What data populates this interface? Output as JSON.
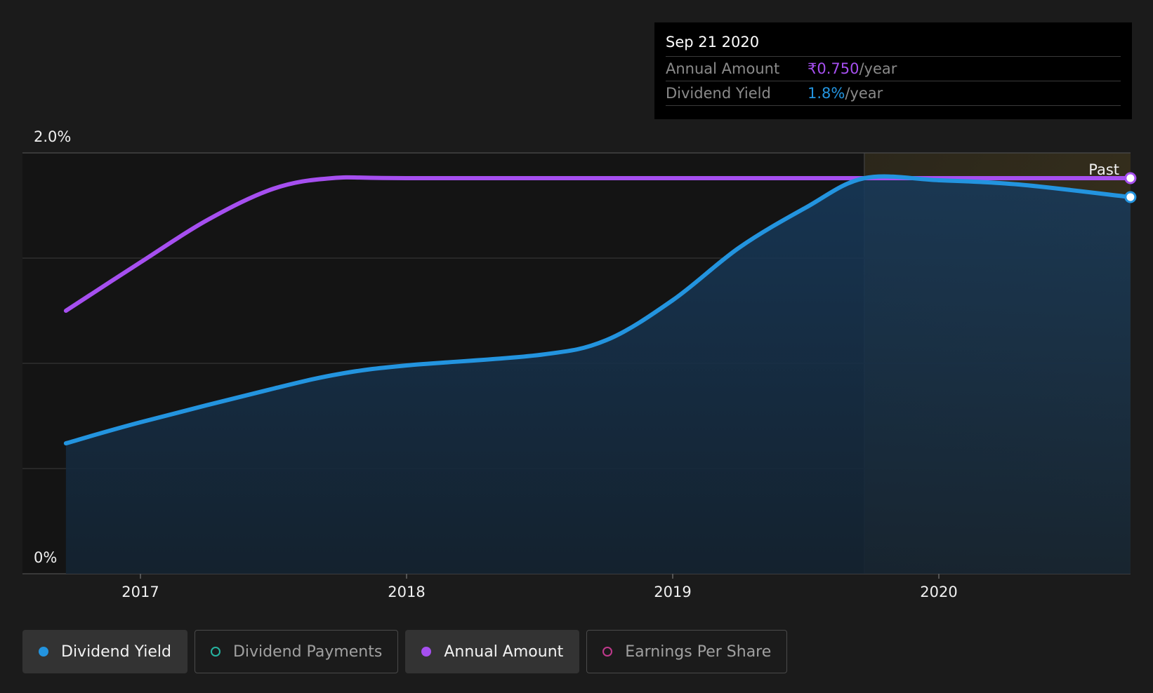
{
  "colors": {
    "background": "#1b1b1b",
    "dividend_yield": "#2394df",
    "annual_amount": "#a64ff0",
    "dividend_payments": "#26b3a0",
    "earnings_per_share": "#c0398c",
    "past_region": "#3e3620"
  },
  "tooltip": {
    "date": "Sep 21 2020",
    "rows": [
      {
        "label": "Annual Amount",
        "value": "₹0.750",
        "unit": "/year"
      },
      {
        "label": "Dividend Yield",
        "value": "1.8%",
        "unit": "/year"
      }
    ]
  },
  "chart_data": {
    "type": "line",
    "x_ticks": [
      "2017",
      "2018",
      "2019",
      "2020"
    ],
    "y_ticks": [
      "2.0%",
      "0%"
    ],
    "ylim": [
      0,
      2.0
    ],
    "xlim": [
      2016.65,
      2020.72
    ],
    "past_label": "Past",
    "past_start": 2019.72,
    "grid": true,
    "series": [
      {
        "name": "Dividend Yield",
        "unit": "%",
        "filled": true,
        "points": [
          [
            2016.72,
            0.62
          ],
          [
            2017.0,
            0.72
          ],
          [
            2017.5,
            0.88
          ],
          [
            2017.75,
            0.95
          ],
          [
            2018.0,
            0.99
          ],
          [
            2018.5,
            1.04
          ],
          [
            2018.75,
            1.11
          ],
          [
            2019.0,
            1.3
          ],
          [
            2019.25,
            1.55
          ],
          [
            2019.5,
            1.74
          ],
          [
            2019.72,
            1.88
          ],
          [
            2020.0,
            1.87
          ],
          [
            2020.3,
            1.85
          ],
          [
            2020.72,
            1.79
          ]
        ]
      },
      {
        "name": "Annual Amount",
        "unit": "₹",
        "filled": false,
        "points": [
          [
            2016.72,
            1.25
          ],
          [
            2017.0,
            1.48
          ],
          [
            2017.25,
            1.68
          ],
          [
            2017.5,
            1.83
          ],
          [
            2017.72,
            1.88
          ],
          [
            2018.0,
            1.88
          ],
          [
            2019.0,
            1.88
          ],
          [
            2020.0,
            1.88
          ],
          [
            2020.72,
            1.88
          ]
        ]
      }
    ]
  },
  "legend": [
    {
      "label": "Dividend Yield",
      "active": true,
      "color": "#2394df",
      "filled": true
    },
    {
      "label": "Dividend Payments",
      "active": false,
      "color": "#26b3a0",
      "filled": false
    },
    {
      "label": "Annual Amount",
      "active": true,
      "color": "#a64ff0",
      "filled": true
    },
    {
      "label": "Earnings Per Share",
      "active": false,
      "color": "#c0398c",
      "filled": false
    }
  ]
}
